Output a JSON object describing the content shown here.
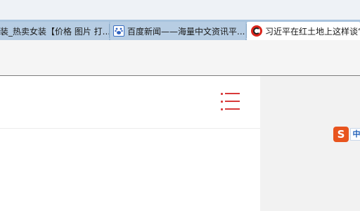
{
  "tabs": [
    {
      "label": "装_热卖女装【价格 图片 打...",
      "favicon": "none",
      "active": false
    },
    {
      "label": "百度新闻——海量中文资讯平...",
      "favicon": "baidu-paw-icon",
      "active": false
    },
    {
      "label": "习近平在红土地上这样谈“",
      "favicon": "red-c-icon",
      "active": true
    }
  ],
  "sidebar": {
    "ime_letter": "S",
    "ime_mode": "中"
  },
  "colors": {
    "tabbar": "#a9c4de",
    "menu_icon": "#d83a3a",
    "ime_brand": "#e8541e"
  }
}
